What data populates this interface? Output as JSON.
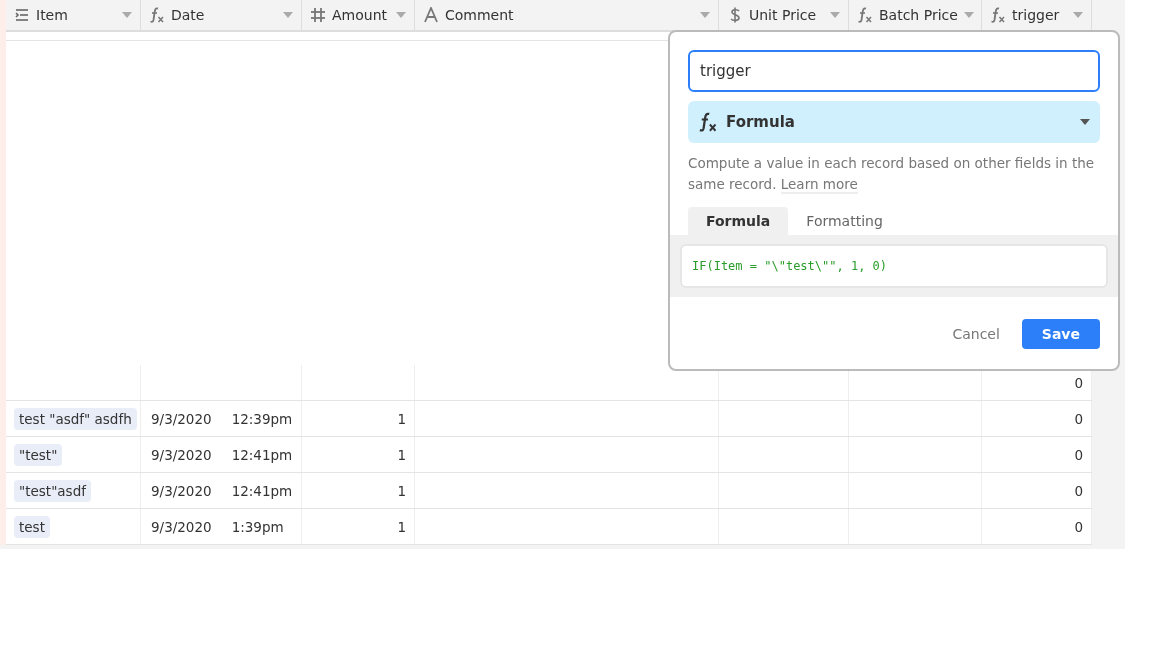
{
  "table": {
    "columns": [
      {
        "label": "Item",
        "kind": "primary"
      },
      {
        "label": "Date",
        "kind": "formula"
      },
      {
        "label": "Amount",
        "kind": "number"
      },
      {
        "label": "Comment",
        "kind": "text"
      },
      {
        "label": "Unit Price",
        "kind": "currency"
      },
      {
        "label": "Batch Price",
        "kind": "formula"
      },
      {
        "label": "trigger",
        "kind": "formula"
      }
    ],
    "rows": [
      {
        "trigger": "0"
      },
      {
        "item": "test \"asdf\" asdfh",
        "date": "9/3/2020",
        "time": "12:39pm",
        "amount": "1",
        "trigger": "0"
      },
      {
        "item": "\"test\"",
        "date": "9/3/2020",
        "time": "12:41pm",
        "amount": "1",
        "trigger": "0"
      },
      {
        "item": "\"test\"asdf",
        "date": "9/3/2020",
        "time": "12:41pm",
        "amount": "1",
        "trigger": "0"
      },
      {
        "item": "test",
        "date": "9/3/2020",
        "time": "1:39pm",
        "amount": "1",
        "trigger": "0"
      }
    ]
  },
  "field_editor": {
    "name": "trigger",
    "type": "Formula",
    "description": "Compute a value in each record based on other fields in the same record.",
    "learn_more": "Learn more",
    "tabs": [
      {
        "label": "Formula",
        "selected": true
      },
      {
        "label": "Formatting",
        "selected": false
      }
    ],
    "formula": "IF(Item = \"\\\"test\\\"\", 1, 0)",
    "buttons": [
      {
        "label": "Cancel",
        "kind": "secondary"
      },
      {
        "label": "Save",
        "kind": "primary"
      }
    ]
  }
}
